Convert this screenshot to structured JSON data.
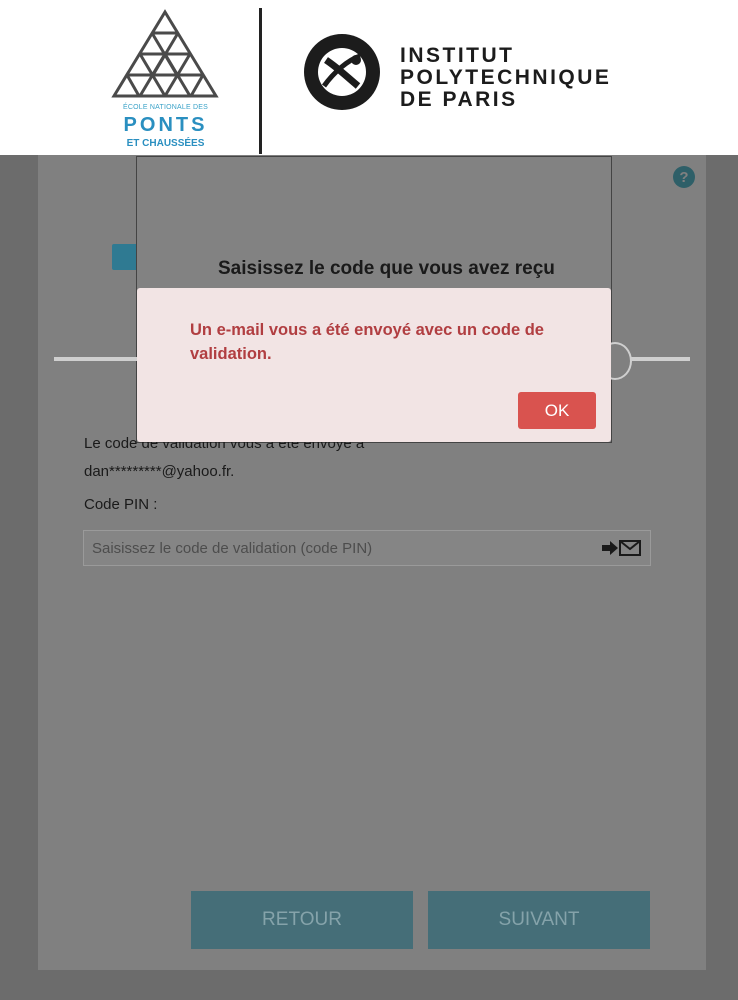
{
  "header": {
    "ponts_logo": {
      "small_text": "ÉCOLE NATIONALE DES",
      "main_text": "PONTS",
      "sub_text": "ET CHAUSSÉES"
    },
    "ipp_logo": {
      "line1": "INSTITUT",
      "line2": "POLYTECHNIQUE",
      "line3": "DE PARIS"
    }
  },
  "page": {
    "title": "Saisissez le code que vous avez reçu",
    "info_line1": "Le code de validation vous a été envoyé à",
    "info_line2": "dan*********@yahoo.fr.",
    "pin_label": "Code PIN :",
    "pin_placeholder": "Saisissez le code de validation (code PIN)",
    "pin_value": ""
  },
  "buttons": {
    "back_label": "RETOUR",
    "next_label": "SUIVANT"
  },
  "alert": {
    "message": "Un e-mail vous a été envoyé avec un code de validation.",
    "ok_label": "OK"
  },
  "icons": {
    "help": "help-icon",
    "unlock": "unlock-icon",
    "send_mail": "send-email-icon"
  },
  "colors": {
    "overlay_bg": "#6c6c6c",
    "button_bg": "#456e78",
    "alert_bg": "#f2e4e4",
    "alert_text": "#b13e41",
    "ok_button": "#d9534f",
    "accent_blue": "#2a8fc0"
  }
}
